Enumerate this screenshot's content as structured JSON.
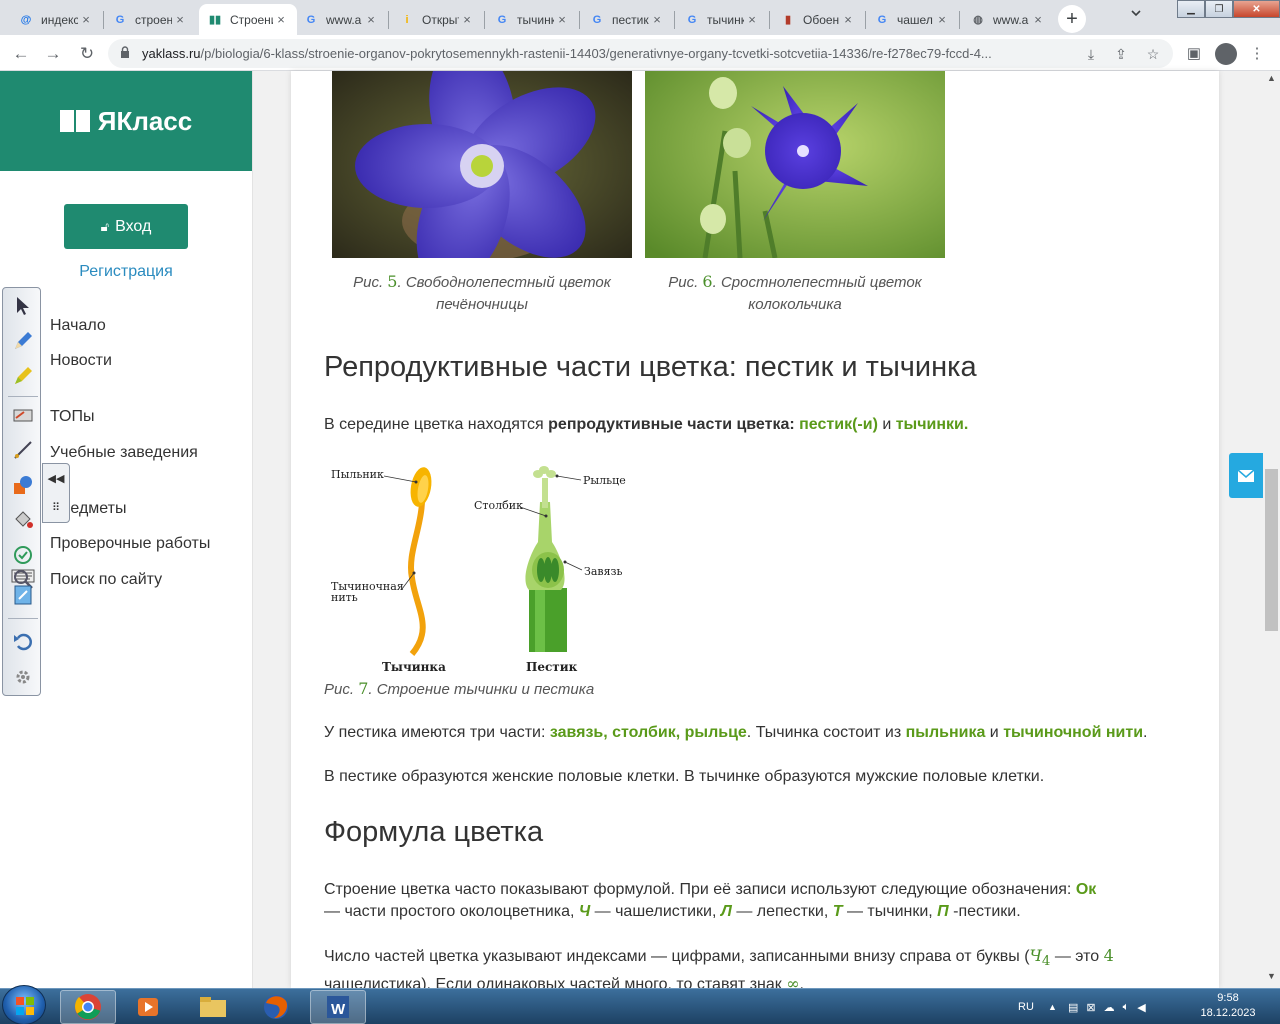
{
  "browser": {
    "tabs": [
      {
        "title": "индекс",
        "favicon": "mail-favicon",
        "color": "#1a73e8"
      },
      {
        "title": "строение",
        "favicon": "google-favicon",
        "color": "#4285f4"
      },
      {
        "title": "Строение",
        "favicon": "yaklass-favicon",
        "color": "#1f8a70",
        "active": true
      },
      {
        "title": "www.a",
        "favicon": "google-favicon",
        "color": "#4285f4"
      },
      {
        "title": "Открыт",
        "favicon": "info-favicon",
        "color": "#f4b400"
      },
      {
        "title": "тычинк",
        "favicon": "google-favicon",
        "color": "#4285f4"
      },
      {
        "title": "пестик",
        "favicon": "google-favicon",
        "color": "#4285f4"
      },
      {
        "title": "тычинк",
        "favicon": "google-favicon",
        "color": "#4285f4"
      },
      {
        "title": "Обоен",
        "favicon": "books-favicon",
        "color": "#b23b2a"
      },
      {
        "title": "чашел",
        "favicon": "google-favicon",
        "color": "#4285f4"
      },
      {
        "title": "www.a",
        "favicon": "globe-favicon",
        "color": "#5f6368"
      }
    ],
    "url_host": "yaklass.ru",
    "url_path": "/p/biologia/6-klass/stroenie-organov-pokrytosemennykh-rastenii-14403/generativnye-organy-tcvetki-sotcvetiia-14336/re-f278ec79-fccd-4..."
  },
  "sidebar": {
    "brand": "ЯКласс",
    "login_label": "Вход",
    "register_label": "Регистрация",
    "items": [
      {
        "label": "Начало"
      },
      {
        "label": "Новости"
      },
      {
        "label": "ТОПы"
      },
      {
        "label": "Учебные заведения"
      },
      {
        "label": "Предметы"
      },
      {
        "label": "Проверочные работы"
      },
      {
        "label": "Поиск по сайту"
      }
    ]
  },
  "figures": {
    "fig5": {
      "prefix": "Рис.",
      "num": "5",
      "text": ". Свободнолепестный цветок печёночницы"
    },
    "fig6": {
      "prefix": "Рис.",
      "num": "6",
      "text": ". Сростнолепестный цветок колокольчика"
    },
    "fig7": {
      "prefix": "Рис.",
      "num": "7",
      "text": ". Строение тычинки и пестика"
    }
  },
  "diagram": {
    "anther": "Пыльник",
    "filament_1": "Тычиночная",
    "filament_2": "нить",
    "stamen": "Тычинка",
    "stigma": "Рыльце",
    "style": "Столбик",
    "ovary": "Завязь",
    "pistil": "Пестик"
  },
  "section1": {
    "heading": "Репродуктивные части цветка: пестик и тычинка",
    "p1_a": "В середине цветка находятся ",
    "p1_b": "репродуктивные части цветка:",
    "p1_c": " ",
    "p1_d": "пестик(-и)",
    "p1_e": " и ",
    "p1_f": "тычинки.",
    "p2_a": "У пестика имеются три части: ",
    "p2_b": "завязь, столбик, рыльце",
    "p2_c": ". Тычинка состоит из ",
    "p2_d": "пыльника",
    "p2_e": " и ",
    "p2_f": "тычиночной нити",
    "p2_g": ".",
    "p3": "В пестике образуются женские половые клетки. В тычинке образуются мужские половые клетки."
  },
  "section2": {
    "heading": "Формула цветка",
    "p1_a": "Строение цветка часто показывают формулой. При её записи используют следующие обозначения: ",
    "p1_ok": "Ок",
    "p1_b": " — части простого околоцветника, ",
    "p1_ch": "Ч",
    "p1_c": " — чашелистики, ",
    "p1_l": "Л",
    "p1_d": " — лепестки, ",
    "p1_t": "Т",
    "p1_e": " — тычинки, ",
    "p1_p": "П",
    "p1_f": " -пестики.",
    "p2_a": "Число частей цветка указывают индексами — цифрами, записанными внизу справа от буквы (",
    "p2_ch": "Ч",
    "p2_sub": "4",
    "p2_b": " — это ",
    "p2_n": "4",
    "p2_c": " чашелистика). Если одинаковых частей много, то ставят знак ",
    "p2_inf": "∞",
    "p2_d": "."
  },
  "taskbar": {
    "lang": "RU",
    "time": "9:58",
    "date": "18.12.2023"
  },
  "colors": {
    "brand": "#1f8a70",
    "accent_green": "#5a9a1a",
    "link": "#2a8bbf"
  }
}
